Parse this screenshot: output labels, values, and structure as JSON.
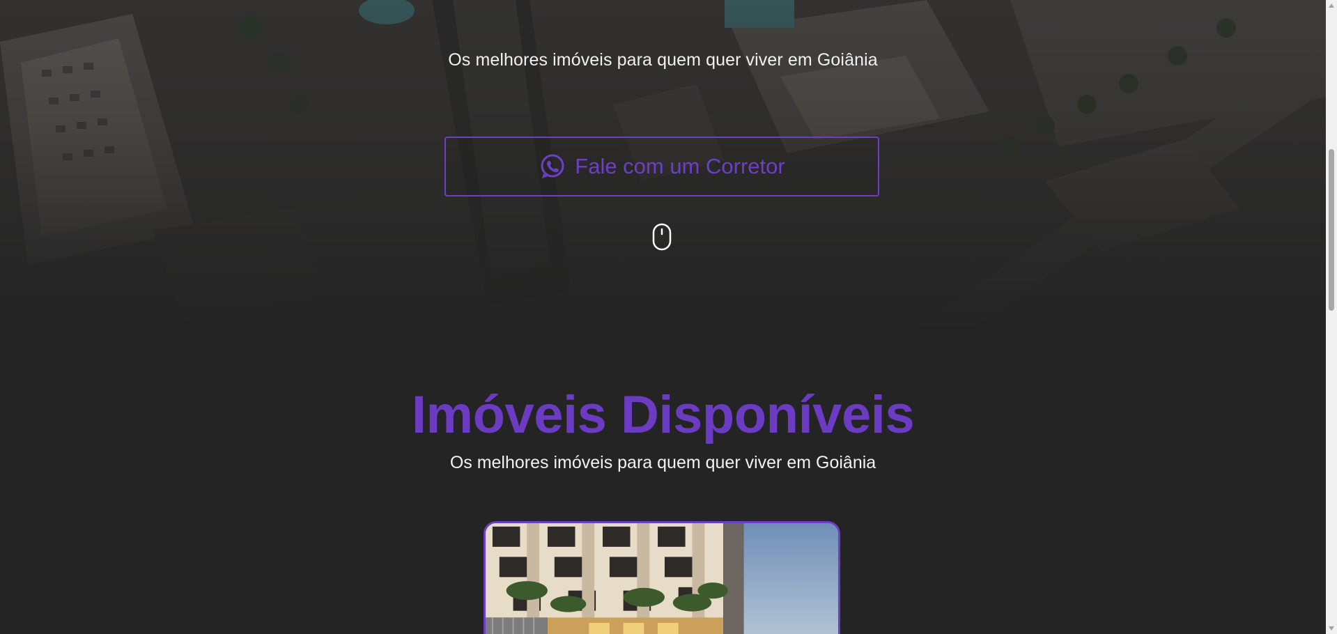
{
  "hero": {
    "tagline": "Os melhores imóveis para quem quer viver em Goiânia",
    "cta_label": "Fale com um Corretor",
    "cta_icon": "whatsapp-icon",
    "scroll_icon": "mouse-scroll-icon"
  },
  "listings": {
    "title": "Imóveis Disponíveis",
    "subtitle": "Os melhores imóveis para quem quer viver em Goiânia"
  },
  "colors": {
    "background": "#242424",
    "accent": "#6b3bc2",
    "text": "#f1f1f1"
  }
}
